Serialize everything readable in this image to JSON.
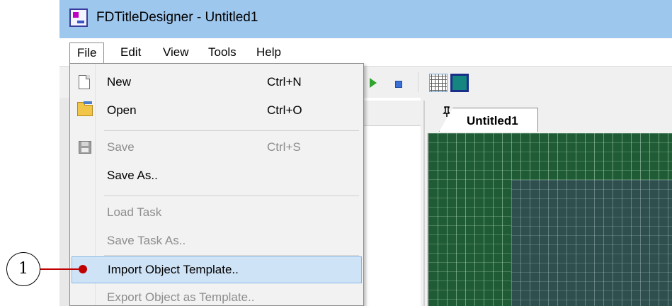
{
  "window": {
    "title": "FDTitleDesigner - Untitled1",
    "app_icon": "app-icon"
  },
  "menubar": {
    "items": [
      {
        "label": "File",
        "state": "open"
      },
      {
        "label": "Edit"
      },
      {
        "label": "View"
      },
      {
        "label": "Tools"
      },
      {
        "label": "Help"
      }
    ]
  },
  "file_menu": {
    "items": [
      {
        "label": "New",
        "shortcut": "Ctrl+N",
        "icon": "new-document-icon",
        "enabled": true
      },
      {
        "label": "Open",
        "shortcut": "Ctrl+O",
        "icon": "open-folder-icon",
        "enabled": true
      },
      {
        "label": "Save",
        "shortcut": "Ctrl+S",
        "icon": "save-disk-icon",
        "enabled": false
      },
      {
        "label": "Save As..",
        "shortcut": "",
        "enabled": true
      },
      {
        "label": "Load Task",
        "shortcut": "",
        "enabled": false
      },
      {
        "label": "Save Task As..",
        "shortcut": "",
        "enabled": false
      },
      {
        "label": "Import Object Template..",
        "shortcut": "",
        "enabled": true,
        "highlighted": true
      },
      {
        "label": "Export Object as Template..",
        "shortcut": "",
        "enabled": false
      }
    ]
  },
  "toolbar": {
    "icons": [
      "play-icon",
      "stop-icon",
      "grid-toggle-icon",
      "safe-frame-icon"
    ]
  },
  "panel": {
    "pin_glyph": "1",
    "close_glyph": "✕"
  },
  "document_tabs": [
    {
      "label": "Untitled1",
      "active": true
    }
  ],
  "callout": {
    "number": "1",
    "color": "#c00000"
  },
  "colors": {
    "titlebar": "#9ec7ee",
    "highlight": "#cfe3f7",
    "canvas_green": "#1f5c35",
    "canvas_inner": "#2f4f4f"
  }
}
